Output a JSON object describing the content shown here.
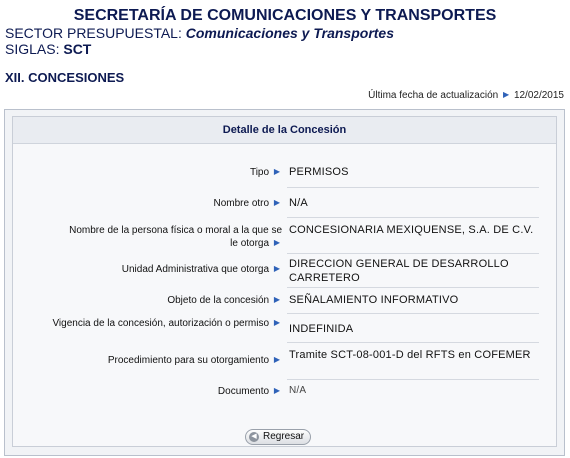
{
  "header": {
    "title": "SECRETARÍA DE COMUNICACIONES Y TRANSPORTES",
    "sector_label": "SECTOR PRESUPUESTAL:",
    "sector_value": "Comunicaciones y Transportes",
    "siglas_label": "SIGLAS:",
    "siglas_value": "SCT"
  },
  "section_title": "XII. CONCESIONES",
  "update": {
    "label": "Última fecha de actualización",
    "date": "12/02/2015"
  },
  "panel": {
    "title": "Detalle de la Concesión",
    "fields": [
      {
        "label": "Tipo",
        "value": "PERMISOS"
      },
      {
        "label": "Nombre otro",
        "value": "N/A"
      },
      {
        "label": "Nombre de la persona física o moral a la que se le otorga",
        "value": "CONCESIONARIA MEXIQUENSE, S.A. DE C.V."
      },
      {
        "label": "Unidad Administrativa que otorga",
        "value": "DIRECCION GENERAL DE DESARROLLO CARRETERO"
      },
      {
        "label": "Objeto de la concesión",
        "value": "SEÑALAMIENTO INFORMATIVO"
      },
      {
        "label": "Vigencia de la concesión, autorización o permiso",
        "value": "INDEFINIDA"
      },
      {
        "label": "Procedimiento para su otorgamiento",
        "value": "Tramite SCT-08-001-D del RFTS en COFEMER"
      },
      {
        "label": "Documento",
        "value": "N/A"
      }
    ],
    "back_button": "Regresar"
  },
  "icons": {
    "label_arrow": "right-triangle-icon",
    "back": "back-arrow-icon"
  },
  "colors": {
    "heading": "#0d1a52",
    "arrow": "#2f62b8",
    "panel_bg": "#f1f3f6"
  }
}
